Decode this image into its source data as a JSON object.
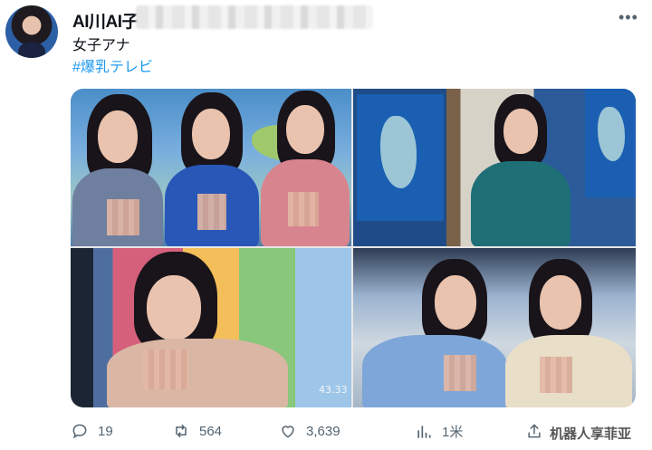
{
  "tweet": {
    "display_name": "AI川AI子",
    "text_line1": "女子アナ",
    "text_line2": "#爆乳テレビ"
  },
  "images": {
    "count": 4,
    "screen_text": "43.33"
  },
  "actions": {
    "replies": "19",
    "retweets": "564",
    "likes": "3,639",
    "views": "1米"
  },
  "watermark": "机器人享菲亚",
  "icons": [
    "more-icon",
    "reply-icon",
    "retweet-icon",
    "like-icon",
    "views-icon",
    "share-icon"
  ]
}
